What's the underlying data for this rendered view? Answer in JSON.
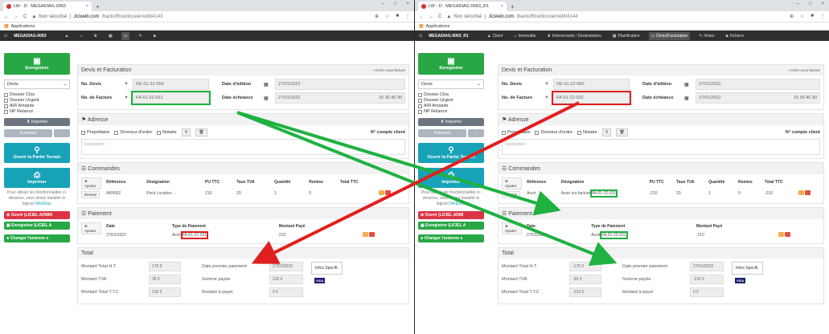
{
  "left": {
    "tab_title": "LW - D : MEGADIAG-0063",
    "url_secure": "Non sécurisé",
    "url_host": ".liciweb.com",
    "url_path": "/backoffice/dossier/edit/4143",
    "bookmarks": "Applications",
    "app_title": "MEGADIAG-0063",
    "sidebar": {
      "save": "Enregistrer",
      "select": "Devis",
      "checks": [
        "Dossier Clos",
        "Dossier Urgent",
        "A/R Amiante",
        "NP Relance"
      ],
      "import": "Importer",
      "extranet": "Extranet",
      "open_terrain": "Ouvrir la Partie Terrain",
      "print": "Imprimer",
      "note": "Pour utiliser les fonctionnalités ci-dessous, vous devez installer le logiciel",
      "note_link": "WebDav.",
      "red_btn": "Ouvrir (LICIEL ADMIN",
      "green_btn": "Enregistrer (LICIEL A",
      "change_btn": "Changer l'antenne s"
    },
    "devis": {
      "header": "Devis et Facturation",
      "create": "Créer sous facture",
      "no_devis_lbl": "No. Devis",
      "no_devis_val": "DE-01-22-059",
      "date_edition_lbl": "Date d'édition",
      "date_edition_val": "27/01/2022",
      "no_facture_lbl": "No. de Facture",
      "no_facture_val": "FA-01-22-031",
      "date_echeance_lbl": "Date échéance",
      "date_echeance_val": "27/01/2022",
      "echeance_extra": "15  30  45  90"
    },
    "adresse": {
      "header": "Adresse",
      "proprietaire": "Propriétaire",
      "donneur": "Donneur d'ordre",
      "notaire": "Notaire",
      "compte": "N° compte client",
      "facturation": "Facturation"
    },
    "commandes": {
      "header": "Commandes",
      "ajouter": "Ajouter",
      "remise": "Remise",
      "cols": [
        "Référence",
        "Désignation",
        "PU TTC",
        "Taux TVA",
        "Quantité",
        "Remise",
        "Total TTC"
      ],
      "row": [
        "840I002",
        "Pack Location ...",
        "210",
        "20",
        "1",
        "0",
        ""
      ]
    },
    "paiement": {
      "header": "Paiement",
      "ajouter": "Ajouter",
      "cols": [
        "Date",
        "Type de Paiement",
        "Montant Payé"
      ],
      "date": "27/01/2022",
      "type_prefix": "Avoir",
      "type_ref": "FA-01-22-031",
      "montant": "210"
    },
    "total": {
      "header": "Total",
      "ht_lbl": "Montant Total H.T.",
      "ht_val": "175 €",
      "tva_lbl": "Montant TVA",
      "tva_val": "35 €",
      "ttc_lbl": "Montant Total T.T.C",
      "ttc_val": "210 €",
      "date_pay_lbl": "Date premier paiement",
      "date_pay_val": "27/01/2022",
      "somme_lbl": "Somme payée",
      "somme_val": "210 €",
      "reste_lbl": "Restant à payer",
      "reste_val": "0 €",
      "info": "Infos Specifi.",
      "visa": "VISA"
    }
  },
  "right": {
    "tab_title": "LW - D : MEGADIAG-0063_R1",
    "url_secure": "Non sécurisé",
    "url_host": ".liciweb.com",
    "url_path": "/backoffice/dossier/edit/4144",
    "bookmarks": "Applications",
    "app_title": "MEGADIAG-0063_R1",
    "nav": [
      "Client",
      "Immeuble",
      "Intervenants / Destinataires",
      "Planification",
      "Devis/Facturation",
      "Notes",
      "Fichiers"
    ],
    "sidebar": {
      "save": "Enregistrer",
      "select": "Devis",
      "checks": [
        "Dossier Clos",
        "Dossier Urgent",
        "A/R Amiante",
        "NP Relance"
      ],
      "import": "Importer",
      "extranet": "Extranet",
      "open_terrain": "Ouvrir la Partie Terrain",
      "print": "Imprimer",
      "note": "Pour utiliser les fonctionnalités ci-dessous, vous devez installer le logiciel",
      "note_link": "WebDav.",
      "red_btn": "Ouvrir (LICIEL ADMI",
      "green_btn": "Enregistrer (LICIEL A",
      "change_btn": "Changer l'antenne s"
    },
    "devis": {
      "header": "Devis et Facturation",
      "create": "Créer sous facture",
      "no_devis_lbl": "No. Devis",
      "no_devis_val": "DE-01-22-060",
      "date_edition_lbl": "Date d'édition",
      "date_edition_val": "27/01/2022",
      "no_facture_lbl": "No. de Facture",
      "no_facture_val": "FA-01-22-032",
      "date_echeance_lbl": "Date échéance",
      "date_echeance_val": "27/01/2022",
      "echeance_extra": "15  30  45  90"
    },
    "adresse": {
      "header": "Adresse",
      "proprietaire": "Propriétaire",
      "donneur": "Donneur d'ordre",
      "notaire": "Notaire",
      "compte": "N° compte client",
      "facturation": "Facturation"
    },
    "commandes": {
      "header": "Commandes",
      "ajouter": "Ajouter",
      "remise": "Remise",
      "cols": [
        "Référence",
        "Désignation",
        "PU TTC",
        "Taux TVA",
        "Quantité",
        "Remise",
        "Total TTC"
      ],
      "row_ref": "Avoir",
      "row_des_prefix": "Avoir sur facture",
      "row_des_ref": "FA-01-22-031",
      "row": [
        "-210",
        "20",
        "1",
        "0",
        "-210"
      ]
    },
    "paiement": {
      "header": "Paiement",
      "ajouter": "Ajouter",
      "cols": [
        "Date",
        "Type de Paiement",
        "Montant Payé"
      ],
      "date": "27/01/2022",
      "type_prefix": "Avoir",
      "type_ref": "FA-01-22-031",
      "montant": "-210"
    },
    "total": {
      "header": "Total",
      "ht_lbl": "Montant Total H.T.",
      "ht_val": "-175 €",
      "tva_lbl": "Montant TVA",
      "tva_val": "-35 €",
      "ttc_lbl": "Montant Total T.T.C",
      "ttc_val": "-210 €",
      "date_pay_lbl": "Date premier paiement",
      "date_pay_val": "27/01/2022",
      "somme_lbl": "Somme payée",
      "somme_val": "-210 €",
      "reste_lbl": "Restant à payer",
      "reste_val": "0 €",
      "info": "Infos Specifi.",
      "visa": "VISA"
    }
  },
  "colors": {
    "green_arrow": "#1fb141",
    "red_arrow": "#e0201f",
    "app_green": "#28a745",
    "app_teal": "#17a2b8"
  }
}
